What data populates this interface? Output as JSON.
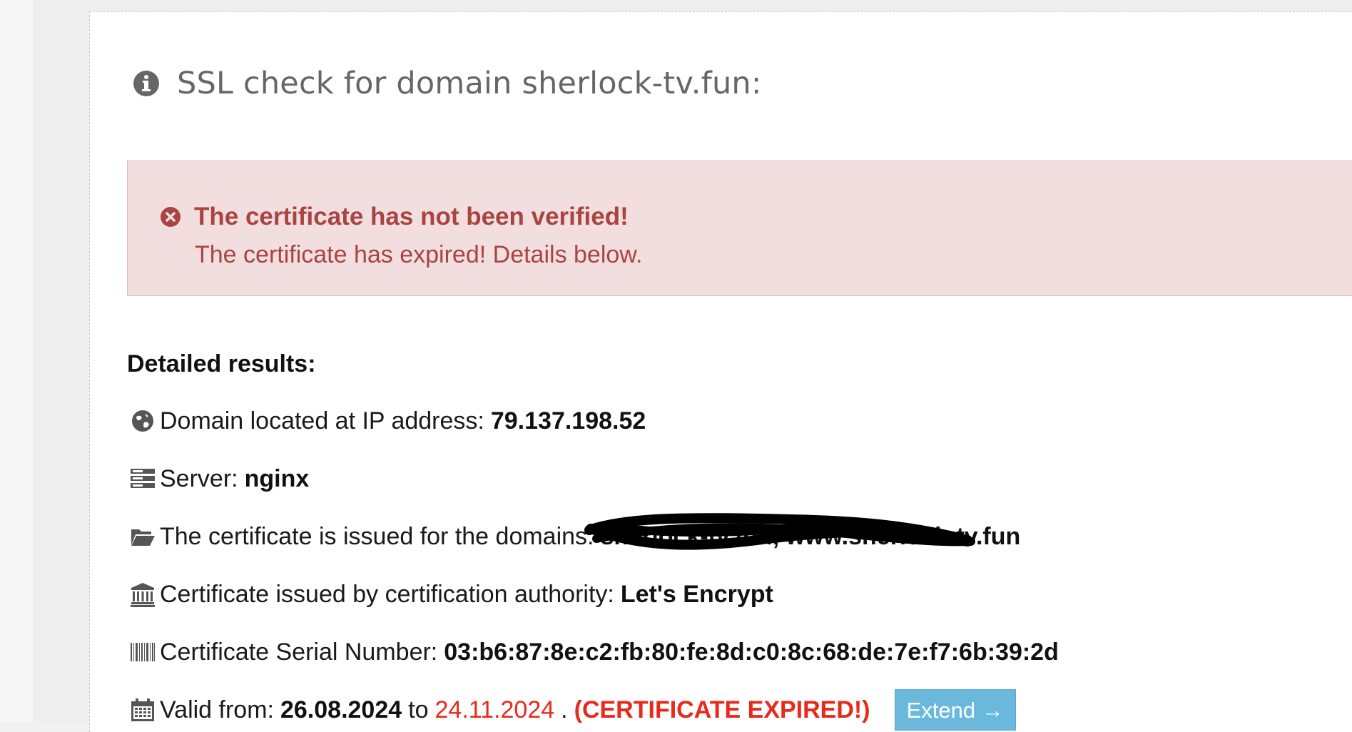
{
  "title": "SSL check for domain sherlock-tv.fun:",
  "alert": {
    "title": "The certificate has not been verified!",
    "message": "The certificate has expired! Details below."
  },
  "details": {
    "heading": "Detailed results:",
    "ip": {
      "label": "Domain located at IP address:",
      "value": "79.137.198.52"
    },
    "server": {
      "label": "Server:",
      "value": "nginx"
    },
    "domains": {
      "label": "The certificate is issued for the domains:",
      "value": "sherlock-tv.fun, www.sherlock-tv.fun"
    },
    "issuer": {
      "label": "Certificate issued by certification authority:",
      "value": "Let's Encrypt"
    },
    "serial": {
      "label": "Certificate Serial Number:",
      "value": "03:b6:87:8e:c2:fb:80:fe:8d:c0:8c:68:de:7e:f7:6b:39:2d"
    },
    "validity": {
      "label": "Valid from:",
      "from": "26.08.2024",
      "to_word": "to",
      "to": "24.11.2024",
      "dot": ".",
      "status": "(CERTIFICATE EXPIRED!)",
      "extend_label": "Extend →"
    }
  },
  "icons": {
    "title": "info-circle-icon",
    "alert": "error-circle-icon",
    "ip": "globe-icon",
    "server": "server-icon",
    "domains": "folder-open-icon",
    "issuer": "institution-icon",
    "serial": "barcode-icon",
    "validity": "calendar-icon"
  },
  "colors": {
    "alert_bg": "#f2dede",
    "alert_text": "#a94442",
    "expired_text": "#e8291c",
    "extend_button": "#6ab9dd"
  }
}
